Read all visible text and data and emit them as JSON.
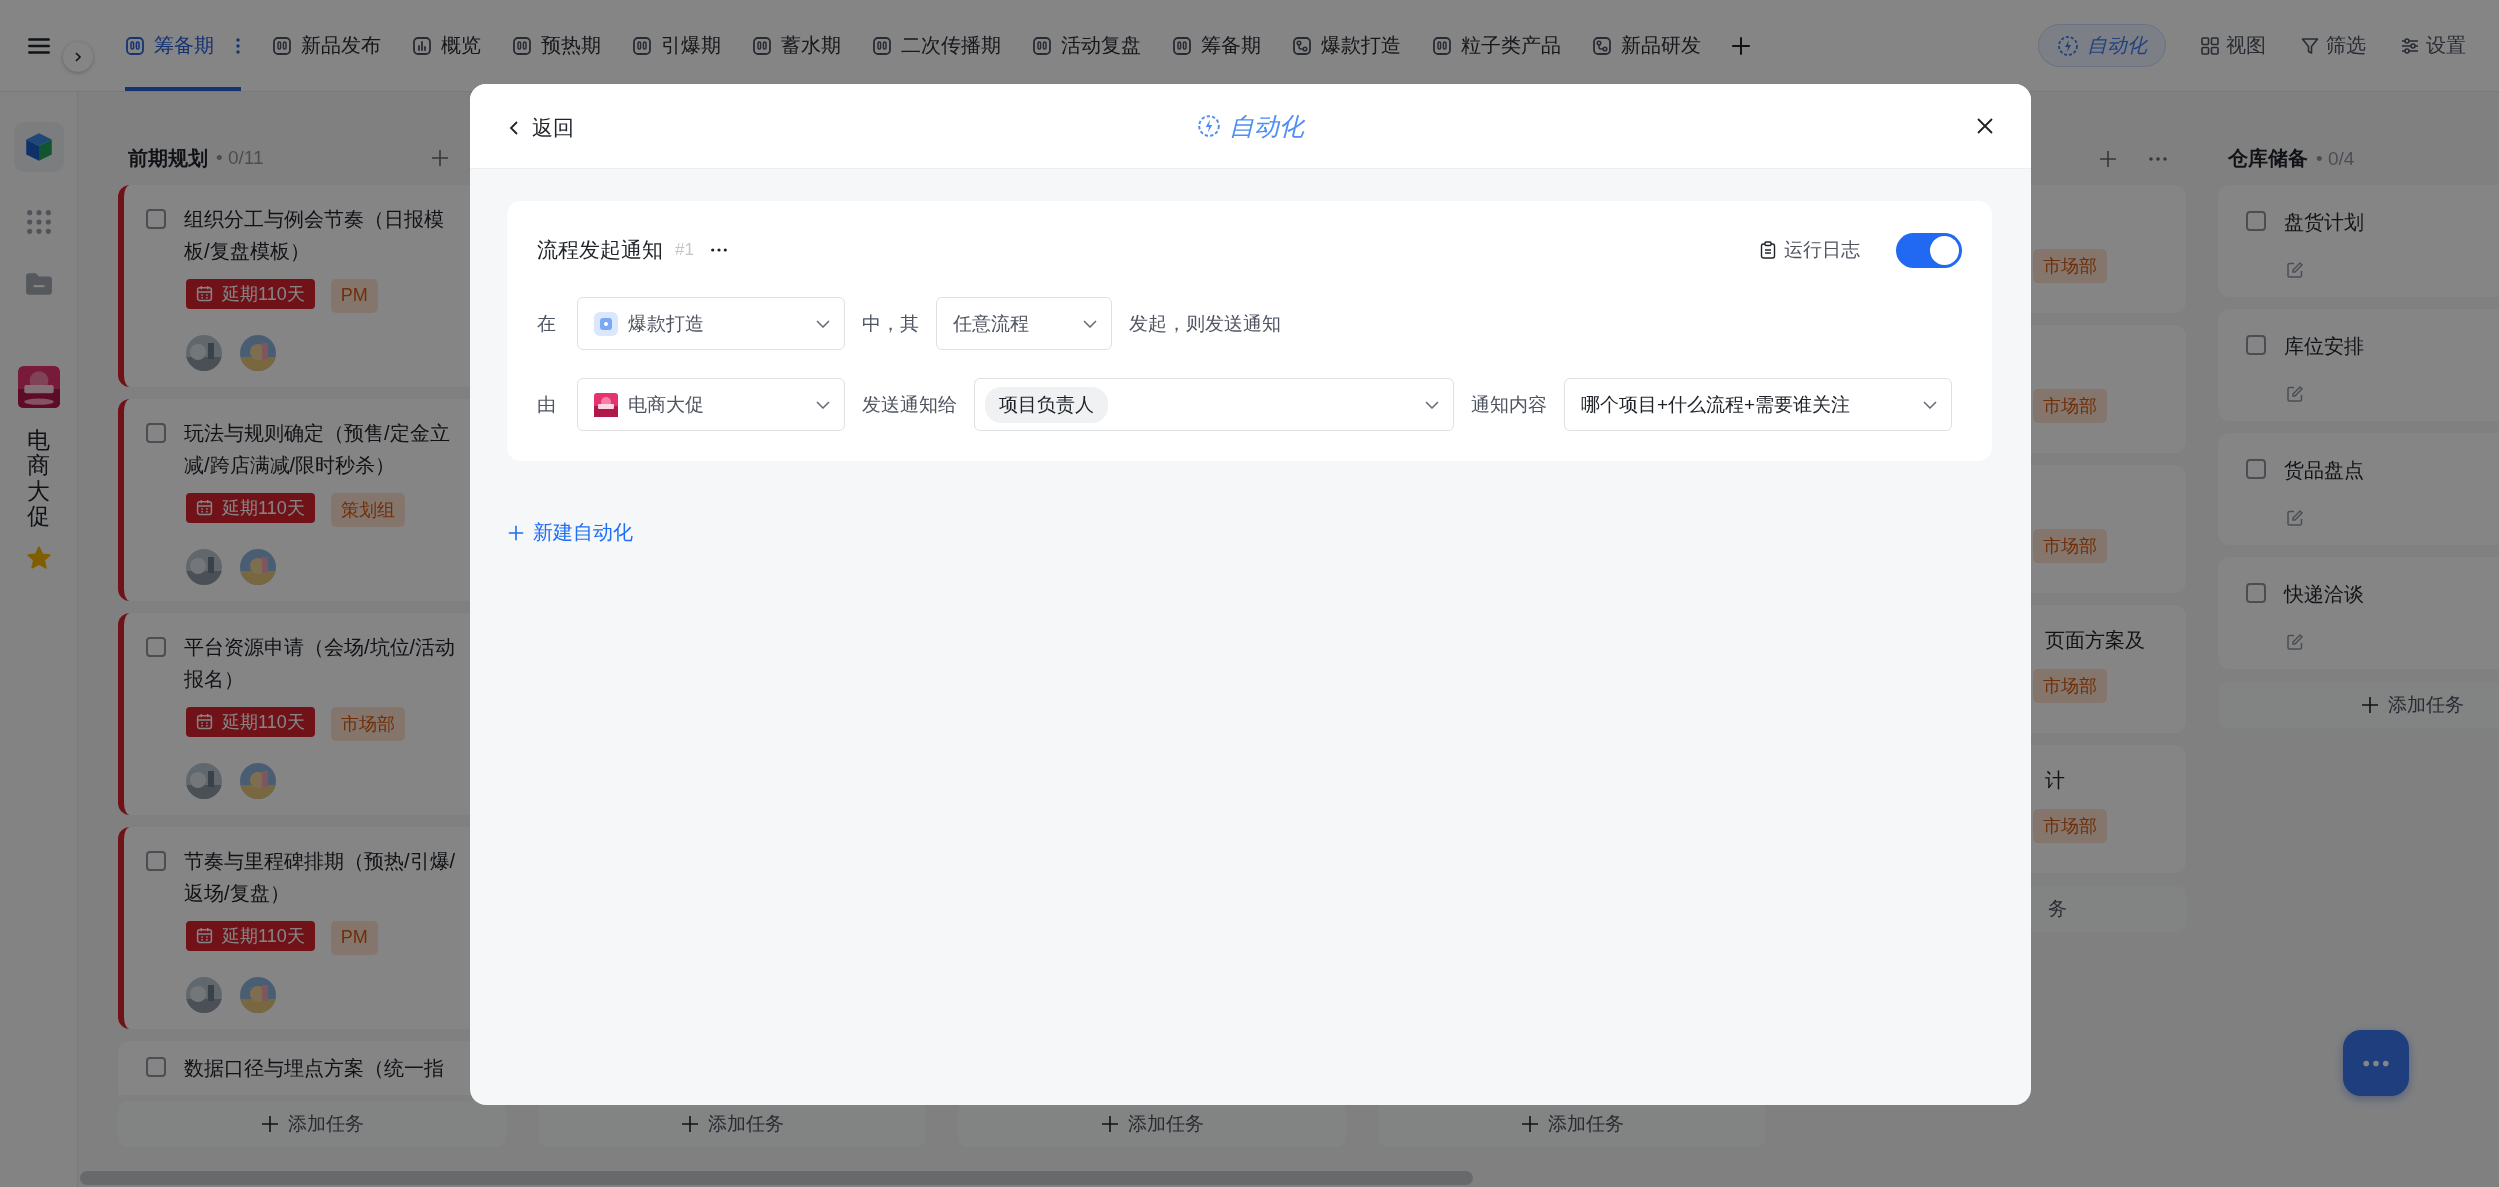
{
  "sidebar": {
    "workspace": "电商大促",
    "starred": true
  },
  "tabs": [
    {
      "label": "筹备期",
      "kind": "board",
      "selected": true
    },
    {
      "label": "新品发布",
      "kind": "board",
      "selected": false
    },
    {
      "label": "概览",
      "kind": "chart",
      "selected": false
    },
    {
      "label": "预热期",
      "kind": "board",
      "selected": false
    },
    {
      "label": "引爆期",
      "kind": "board",
      "selected": false
    },
    {
      "label": "蓄水期",
      "kind": "board",
      "selected": false
    },
    {
      "label": "二次传播期",
      "kind": "board",
      "selected": false
    },
    {
      "label": "活动复盘",
      "kind": "board",
      "selected": false
    },
    {
      "label": "筹备期",
      "kind": "board",
      "selected": false
    },
    {
      "label": "爆款打造",
      "kind": "flow",
      "selected": false
    },
    {
      "label": "粒子类产品",
      "kind": "board",
      "selected": false
    },
    {
      "label": "新品研发",
      "kind": "flow",
      "selected": false
    }
  ],
  "toolbar": {
    "automation": "自动化",
    "actions": [
      {
        "label": "视图",
        "kind": "grid"
      },
      {
        "label": "筛选",
        "kind": "filter"
      },
      {
        "label": "设置",
        "kind": "settings"
      }
    ]
  },
  "columns": [
    {
      "title": "前期规划",
      "count": "• 0/11",
      "cards": [
        {
          "title": "组织分工与例会节奏（日报模板/复盘模板）",
          "checked": false,
          "overdue": "延期110天",
          "tag": "PM"
        },
        {
          "title": "玩法与规则确定（预售/定金立减/跨店满减/限时秒杀）",
          "checked": false,
          "overdue": "延期110天",
          "tag": "策划组"
        },
        {
          "title": "平台资源申请（会场/坑位/活动报名）",
          "checked": false,
          "overdue": "延期110天",
          "tag": "市场部"
        },
        {
          "title": "节奏与里程碑排期（预热/引爆/返场/复盘）",
          "checked": false,
          "overdue": "延期110天",
          "tag": "PM"
        },
        {
          "title": "数据口径与埋点方案（统一指",
          "checked": false
        }
      ],
      "add": "添加任务"
    },
    {
      "add": "添加任务"
    },
    {
      "add": "添加任务"
    },
    {
      "add": "添加任务"
    },
    {
      "fragments": [
        {
          "tag": "市场部"
        },
        {
          "tag": "市场部"
        },
        {
          "tag": "市场部"
        },
        {
          "title": "页面方案及",
          "tag": "市场部"
        },
        {
          "title": "计",
          "tag": "市场部"
        }
      ],
      "add_fragment": "务"
    },
    {
      "title": "仓库储备",
      "count": "• 0/4",
      "cards": [
        {
          "title": "盘货计划",
          "checked": false
        },
        {
          "title": "库位安排",
          "checked": false
        },
        {
          "title": "货品盘点",
          "checked": false
        },
        {
          "title": "快递洽谈",
          "checked": false
        }
      ],
      "add": "添加任务"
    }
  ],
  "modal": {
    "back": "返回",
    "title": "自动化",
    "rule": {
      "name": "流程发起通知",
      "number": "#1",
      "log": "运行日志",
      "enabled": true,
      "condition": {
        "prefix": "在",
        "project": "爆款打造",
        "middle": "中，其",
        "event": "任意流程",
        "suffix": "发起，则发送通知"
      },
      "action": {
        "prefix": "由",
        "sender": "电商大促",
        "recipients_label": "发送通知给",
        "recipients": [
          "项目负责人"
        ],
        "content_label": "通知内容",
        "content": "哪个项目+什么流程+需要谁关注"
      }
    },
    "new_button": "新建自动化"
  }
}
